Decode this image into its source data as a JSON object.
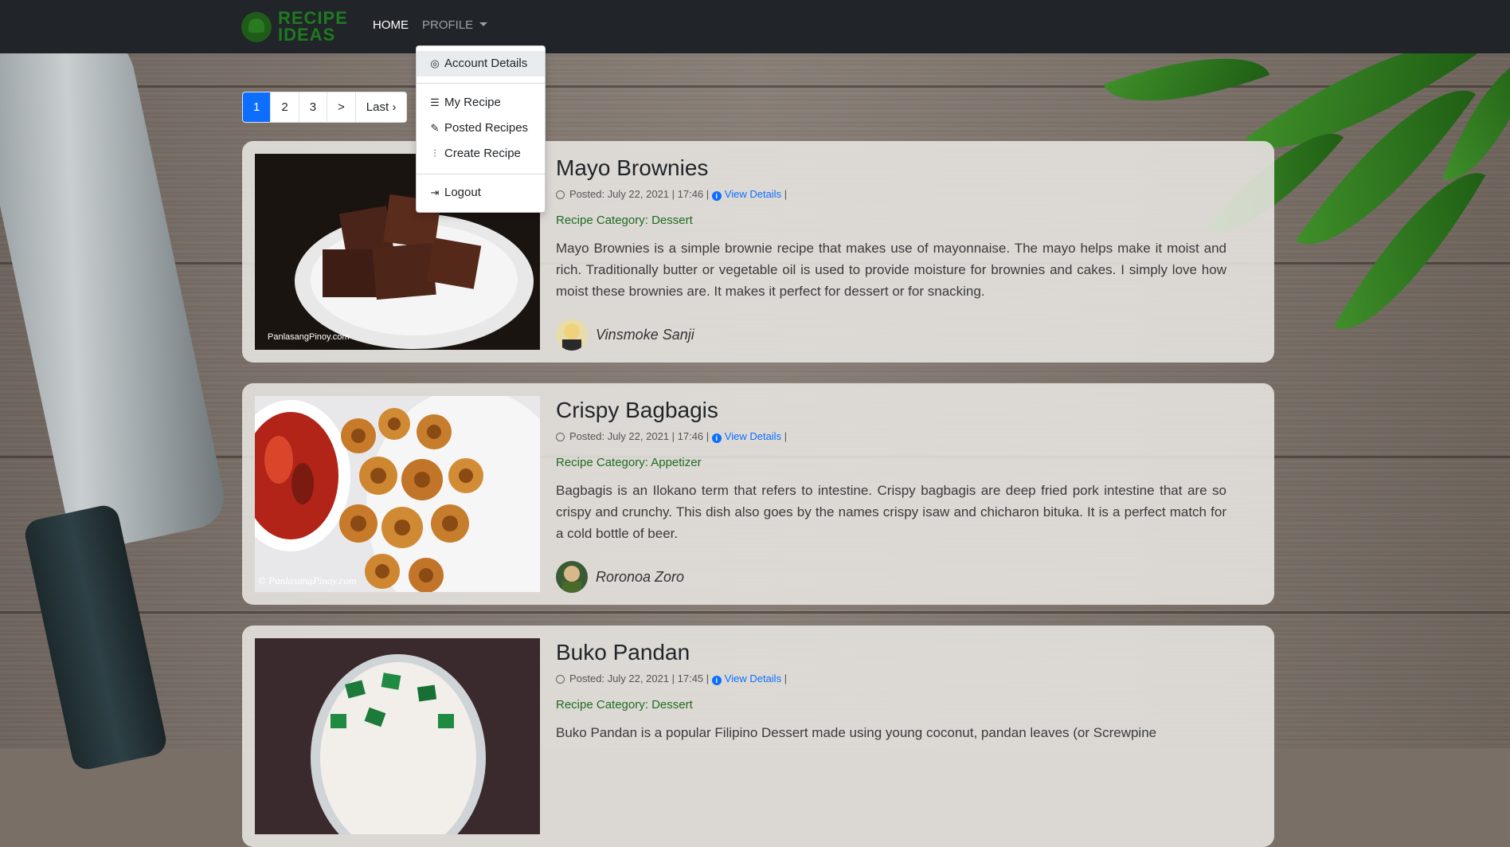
{
  "navbar": {
    "logo_line1": "RECIPE",
    "logo_line2": "IDEAS",
    "home": "HOME",
    "profile": "PROFILE"
  },
  "dropdown": {
    "account_details": "Account Details",
    "my_recipe": "My Recipe",
    "posted_recipes": "Posted Recipes",
    "create_recipe": "Create Recipe",
    "logout": "Logout"
  },
  "pagination": [
    "1",
    "2",
    "3",
    ">",
    "Last ›"
  ],
  "recipes": [
    {
      "title": "Mayo Brownies",
      "posted": "Posted: July 22, 2021 | 17:46 |",
      "view": "View Details",
      "sep": "|",
      "category_label": "Recipe Category: ",
      "category": "Dessert",
      "description": "Mayo Brownies is a simple brownie recipe that makes use of mayonnaise. The mayo helps make it moist and rich. Traditionally butter or vegetable oil is used to provide moisture for brownies and cakes. I simply love how moist these brownies are. It makes it perfect for dessert or for snacking.",
      "author": "Vinsmoke Sanji",
      "watermark": "PanlasangPinoy.com"
    },
    {
      "title": "Crispy Bagbagis",
      "posted": "Posted: July 22, 2021 | 17:46 |",
      "view": "View Details",
      "sep": "|",
      "category_label": "Recipe Category: ",
      "category": "Appetizer",
      "description": "Bagbagis is an Ilokano term that refers to intestine. Crispy bagbagis are deep fried pork intestine that are so crispy and crunchy. This dish also goes by the names crispy isaw and chicharon bituka. It is a perfect match for a cold bottle of beer.",
      "author": "Roronoa Zoro",
      "watermark": "© PanlasangPinoy.com"
    },
    {
      "title": "Buko Pandan",
      "posted": "Posted: July 22, 2021 | 17:45 |",
      "view": "View Details",
      "sep": "|",
      "category_label": "Recipe Category: ",
      "category": "Dessert",
      "description": "Buko Pandan is a popular Filipino Dessert made using young coconut, pandan leaves (or Screwpine",
      "author": "",
      "watermark": ""
    }
  ],
  "colors": {
    "navbar_bg": "#212529",
    "accent": "#0d6efd",
    "category_green": "#1e6b1e",
    "logo_green": "#1e7a1e"
  }
}
